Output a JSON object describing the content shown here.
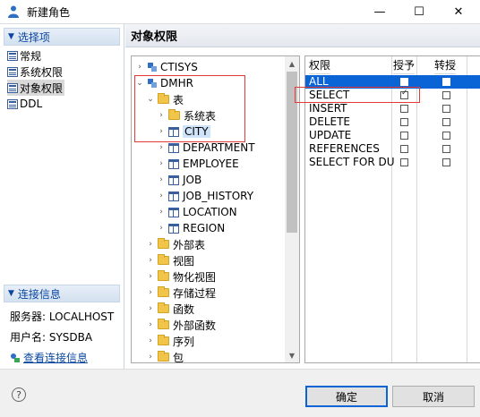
{
  "window": {
    "title": "新建角色",
    "minimize_glyph": "—",
    "maximize_glyph": "☐",
    "close_glyph": "✕"
  },
  "left_panel": {
    "section_options": "选择项",
    "nav_items": [
      "常规",
      "系统权限",
      "对象权限",
      "DDL"
    ],
    "section_connection": "连接信息",
    "server_label": "服务器: LOCALHOST",
    "user_label": "用户名: SYSDBA",
    "view_connection_link": "查看连接信息"
  },
  "right_panel": {
    "header": "对象权限"
  },
  "tree": {
    "items": [
      {
        "label": "CTISYS",
        "icon": "database-icon",
        "toggle": "›"
      },
      {
        "label": "DMHR",
        "icon": "database-icon",
        "toggle": "⌄"
      },
      {
        "label": "表",
        "icon": "folder-icon",
        "toggle": "⌄"
      },
      {
        "label": "系统表",
        "icon": "folder-icon",
        "toggle": "›"
      },
      {
        "label": "CITY",
        "icon": "table-icon",
        "toggle": "›"
      },
      {
        "label": "DEPARTMENT",
        "icon": "table-icon",
        "toggle": "›"
      },
      {
        "label": "EMPLOYEE",
        "icon": "table-icon",
        "toggle": "›"
      },
      {
        "label": "JOB",
        "icon": "table-icon",
        "toggle": "›"
      },
      {
        "label": "JOB_HISTORY",
        "icon": "table-icon",
        "toggle": "›"
      },
      {
        "label": "LOCATION",
        "icon": "table-icon",
        "toggle": "›"
      },
      {
        "label": "REGION",
        "icon": "table-icon",
        "toggle": "›"
      },
      {
        "label": "外部表",
        "icon": "folder-icon",
        "toggle": "›"
      },
      {
        "label": "视图",
        "icon": "folder-icon",
        "toggle": "›"
      },
      {
        "label": "物化视图",
        "icon": "folder-icon",
        "toggle": "›"
      },
      {
        "label": "存储过程",
        "icon": "folder-icon",
        "toggle": "›"
      },
      {
        "label": "函数",
        "icon": "folder-icon",
        "toggle": "›"
      },
      {
        "label": "外部函数",
        "icon": "folder-icon",
        "toggle": "›"
      },
      {
        "label": "序列",
        "icon": "folder-icon",
        "toggle": "›"
      },
      {
        "label": "包",
        "icon": "folder-icon",
        "toggle": "›"
      }
    ],
    "selected": "CITY"
  },
  "privileges": {
    "columns": [
      "权限",
      "授予",
      "转授"
    ],
    "rows": [
      {
        "name": "ALL",
        "grant": false,
        "grant_option": false
      },
      {
        "name": "SELECT",
        "grant": true,
        "grant_option": false
      },
      {
        "name": "INSERT",
        "grant": false,
        "grant_option": false
      },
      {
        "name": "DELETE",
        "grant": false,
        "grant_option": false
      },
      {
        "name": "UPDATE",
        "grant": false,
        "grant_option": false
      },
      {
        "name": "REFERENCES",
        "grant": false,
        "grant_option": false
      },
      {
        "name": "SELECT FOR DU",
        "grant": false,
        "grant_option": false
      }
    ],
    "selected_row": "ALL"
  },
  "footer": {
    "help_glyph": "?",
    "ok_label": "确定",
    "cancel_label": "取消"
  },
  "colors": {
    "selection_blue": "#0a64d6",
    "highlight_red": "#e53935",
    "header_blue_text": "#0b47a0"
  }
}
